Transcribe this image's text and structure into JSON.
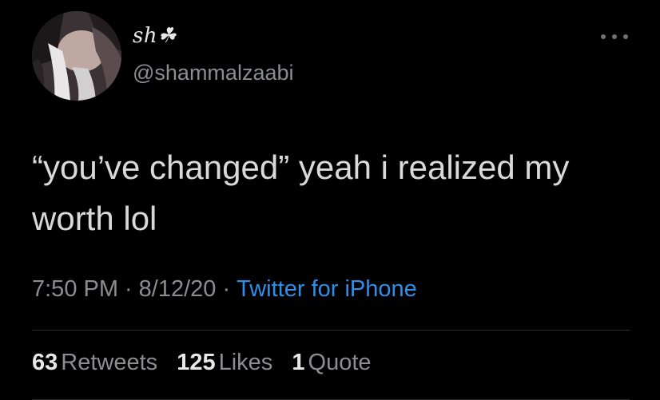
{
  "user": {
    "display_name": "sh☘",
    "handle": "@shammalzaabi"
  },
  "tweet": {
    "text": "“you’ve changed” yeah i realized my worth lol",
    "time": "7:50 PM",
    "date": "8/12/20",
    "separator": "·",
    "source": "Twitter for iPhone"
  },
  "stats": {
    "retweets_count": "63",
    "retweets_label": "Retweets",
    "likes_count": "125",
    "likes_label": "Likes",
    "quotes_count": "1",
    "quotes_label": "Quote"
  },
  "colors": {
    "background": "#000000",
    "text": "#d9d9d9",
    "muted": "#8a8d91",
    "link": "#2e8fe8"
  },
  "icons": {
    "more": "more-horizontal-icon"
  }
}
